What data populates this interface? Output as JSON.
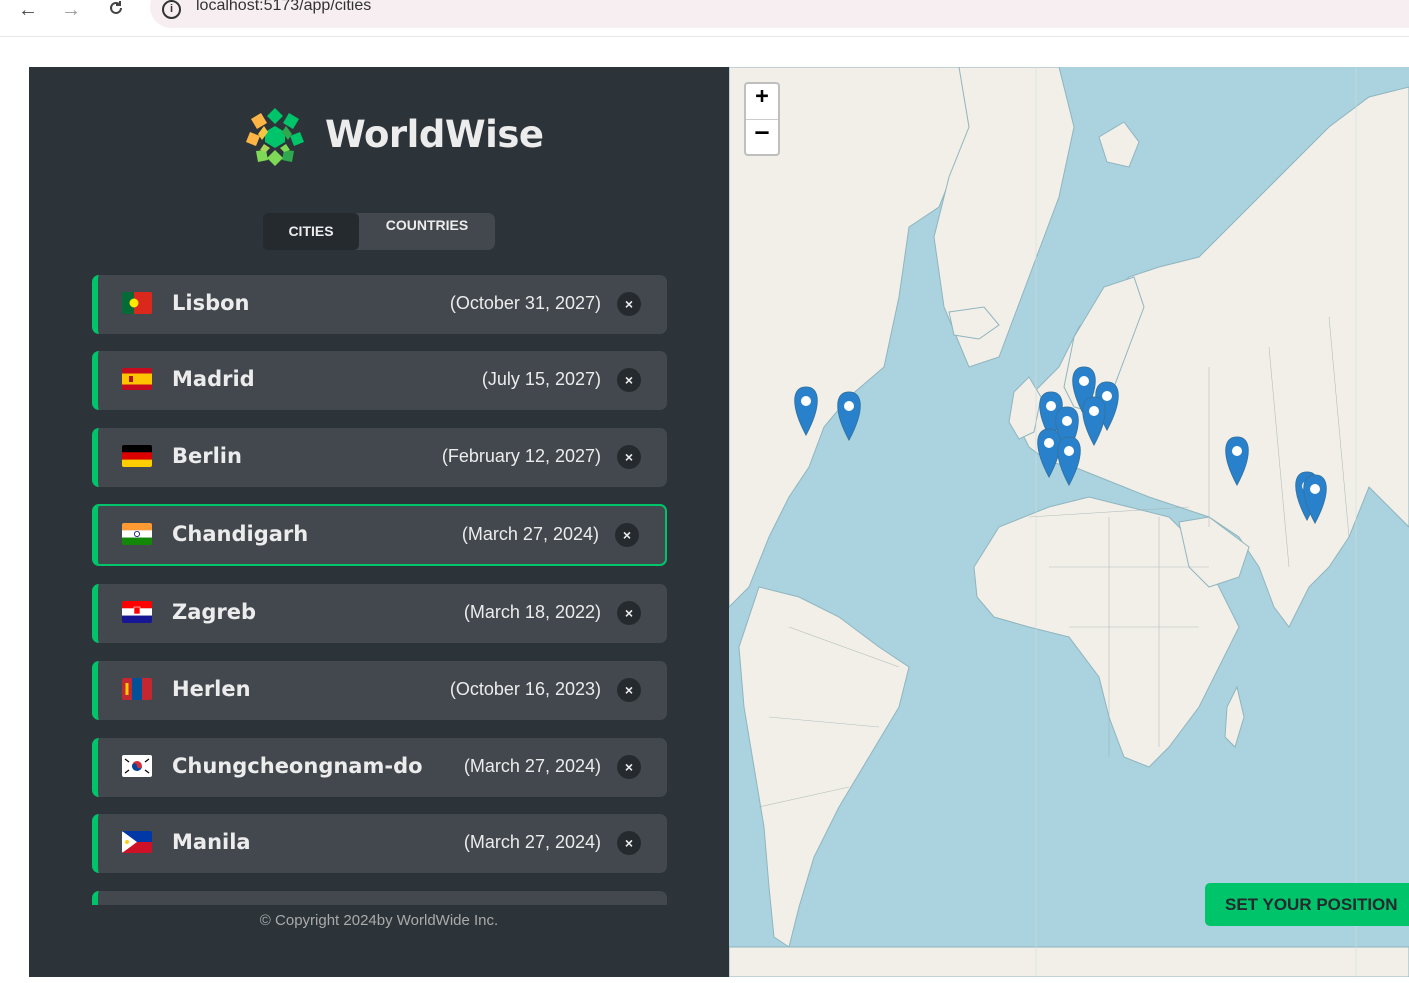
{
  "browser": {
    "url": "localhost:5173/app/cities",
    "back": "←",
    "forward": "→",
    "reload": "C"
  },
  "app": {
    "brand": "WorldWise",
    "tabs": [
      {
        "label": "CITIES",
        "active": true
      },
      {
        "label": "COUNTRIES",
        "active": false
      }
    ],
    "cities": [
      {
        "name": "Lisbon",
        "date": "(October 31, 2027)",
        "flag": "pt",
        "active": false
      },
      {
        "name": "Madrid",
        "date": "(July 15, 2027)",
        "flag": "es",
        "active": false
      },
      {
        "name": "Berlin",
        "date": "(February 12, 2027)",
        "flag": "de",
        "active": false
      },
      {
        "name": "Chandigarh",
        "date": "(March 27, 2024)",
        "flag": "in",
        "active": true
      },
      {
        "name": "Zagreb",
        "date": "(March 18, 2022)",
        "flag": "hr",
        "active": false
      },
      {
        "name": "Herlen",
        "date": "(October 16, 2023)",
        "flag": "mn",
        "active": false
      },
      {
        "name": "Chungcheongnam-do",
        "date": "(March 27, 2024)",
        "flag": "kr",
        "active": false
      },
      {
        "name": "Manila",
        "date": "(March 27, 2024)",
        "flag": "ph",
        "active": false
      }
    ],
    "delete_label": "×",
    "footer": "© Copyright 2024by WorldWide Inc."
  },
  "map": {
    "zoom_in": "+",
    "zoom_out": "–",
    "set_position": "SET YOUR POSITION",
    "colors": {
      "water": "#aad3df",
      "land": "#f2efe9",
      "marker": "#2a81cb"
    }
  },
  "colors": {
    "accent": "#00c46a",
    "sidebar": "#2d3439",
    "card": "#42484d"
  }
}
